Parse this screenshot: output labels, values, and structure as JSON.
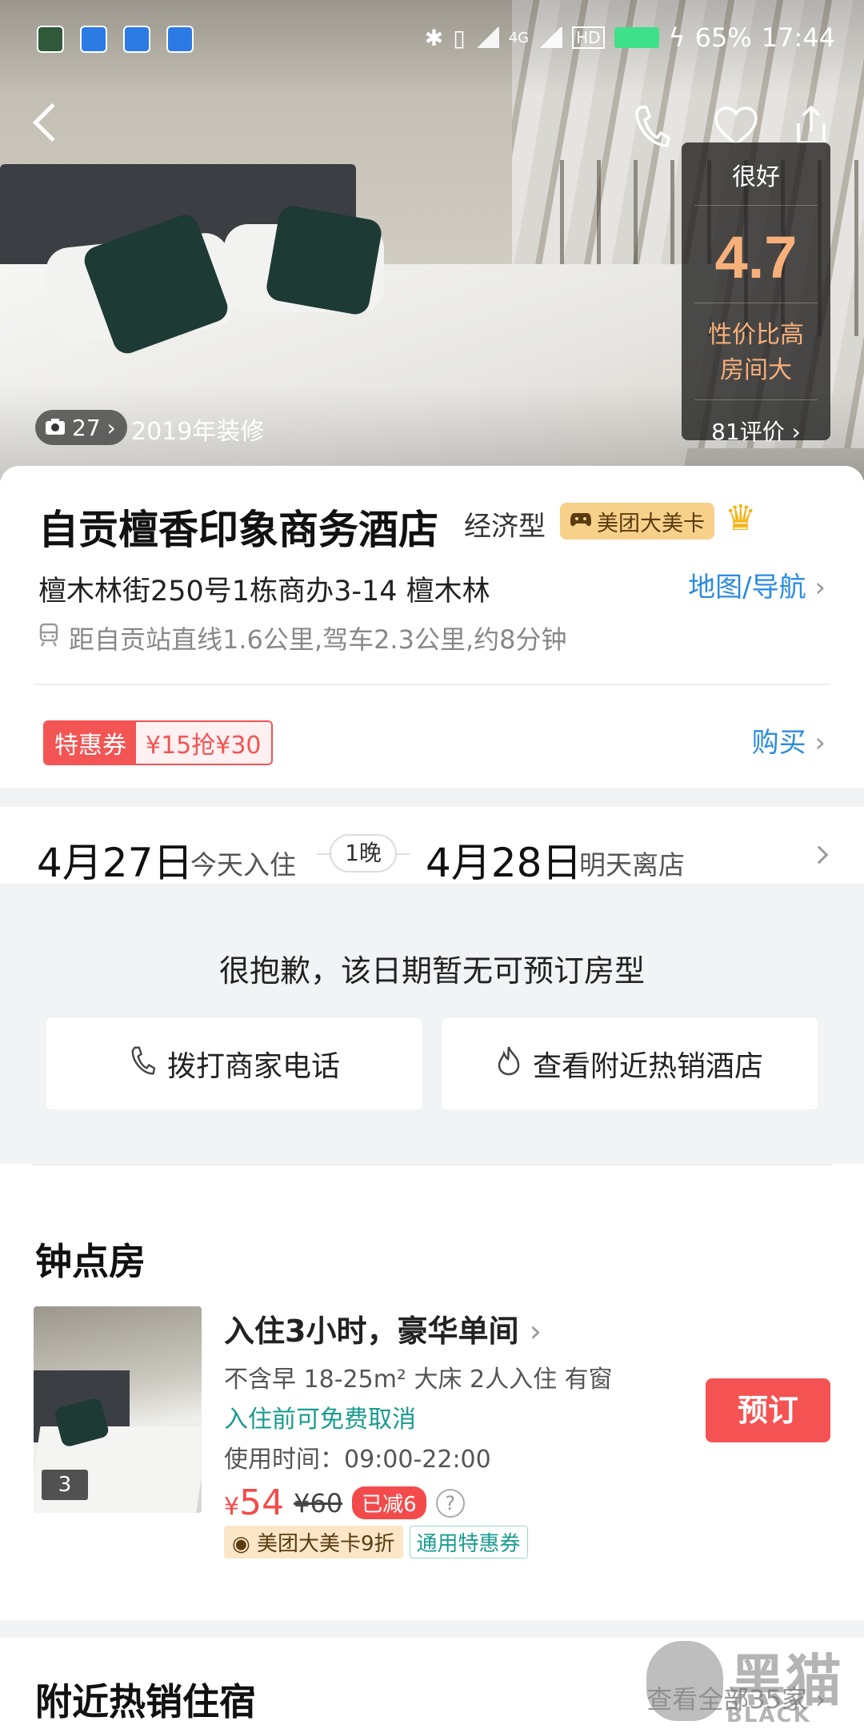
{
  "status_bar": {
    "battery": "65%",
    "time": "17:44",
    "network": "4G",
    "hd": "HD"
  },
  "hero": {
    "photo_count": "27",
    "renovation": "2019年装修"
  },
  "rating": {
    "level": "很好",
    "score": "4.7",
    "tag1": "性价比高",
    "tag2": "房间大",
    "reviews": "81评价"
  },
  "hotel": {
    "name": "自贡檀香印象商务酒店",
    "type": "经济型",
    "member_badge": "美团大美卡",
    "address": "檀木林街250号1栋商办3-14 檀木林",
    "map_link": "地图/导航",
    "distance": "距自贡站直线1.6公里,驾车2.3公里,约8分钟"
  },
  "coupon": {
    "label": "特惠券",
    "offer": "¥15抢¥30",
    "buy": "购买"
  },
  "dates": {
    "checkin_date": "4月27日",
    "checkin_label": "今天入住",
    "nights": "1晚",
    "checkout_date": "4月28日",
    "checkout_label": "明天离店"
  },
  "unavailable": {
    "message": "很抱歉，该日期暂无可预订房型",
    "call_button": "拨打商家电话",
    "nearby_button": "查看附近热销酒店"
  },
  "hourly": {
    "section_title": "钟点房",
    "photo_count": "3",
    "room_name": "入住3小时，豪华单间",
    "spec": "不含早 18-25m² 大床 2人入住 有窗",
    "cancel": "入住前可免费取消",
    "usage_time": "使用时间：09:00-22:00",
    "currency": "¥",
    "price": "54",
    "old_price": "¥60",
    "discount": "已减6",
    "tag_member": "美团大美卡9折",
    "tag_coupon": "通用特惠券",
    "book_button": "预订"
  },
  "nearby": {
    "title": "附近热销住宿",
    "more": "查看全部35家"
  },
  "watermark": {
    "cn": "黑猫",
    "en": "BLACK CAT"
  },
  "colors": {
    "link_blue": "#2a8be0",
    "price_red": "#f34b4b",
    "rating_orange": "#f7b07a",
    "cancel_teal": "#1a9c8f",
    "badge_gold": "#f7d08a"
  }
}
